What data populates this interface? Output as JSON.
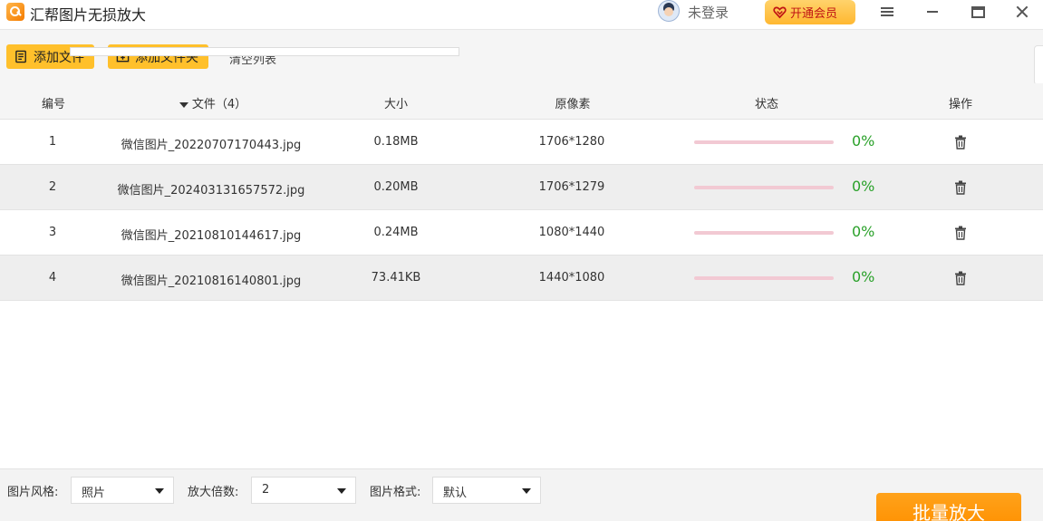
{
  "app": {
    "title": "汇帮图片无损放大",
    "login_label": "未登录",
    "vip_label": "开通会员"
  },
  "toolbar": {
    "add_file_label": "添加文件",
    "add_folder_label": "添加文件夹",
    "clear_label": "清空列表"
  },
  "table": {
    "headers": {
      "index": "编号",
      "file": "文件（4）",
      "size": "大小",
      "pixels": "原像素",
      "status": "状态",
      "action": "操作"
    },
    "rows": [
      {
        "index": "1",
        "file": "微信图片_20220707170443.jpg",
        "size": "0.18MB",
        "pixels": "1706*1280",
        "progress": 0,
        "progress_label": "0%"
      },
      {
        "index": "2",
        "file": "微信图片_202403131657572.jpg",
        "size": "0.20MB",
        "pixels": "1706*1279",
        "progress": 0,
        "progress_label": "0%"
      },
      {
        "index": "3",
        "file": "微信图片_20210810144617.jpg",
        "size": "0.24MB",
        "pixels": "1080*1440",
        "progress": 0,
        "progress_label": "0%"
      },
      {
        "index": "4",
        "file": "微信图片_20210816140801.jpg",
        "size": "73.41KB",
        "pixels": "1440*1080",
        "progress": 0,
        "progress_label": "0%"
      }
    ]
  },
  "options": {
    "style_label": "图片风格:",
    "style_value": "照片",
    "scale_label": "放大倍数:",
    "scale_value": "2",
    "format_label": "图片格式:",
    "format_value": "默认"
  },
  "actions": {
    "batch_label": "批量放大"
  },
  "colors": {
    "accent": "#ffc02b",
    "primary_button": "#ff9800",
    "progress_track": "#f2c9d3",
    "percent_text": "#2aa12a",
    "vip_text": "#c01414"
  },
  "icons": [
    "app-logo-icon",
    "user-avatar-icon",
    "vip-heart-icon",
    "menu-icon",
    "minimize-icon",
    "maximize-icon",
    "close-icon",
    "add-file-icon",
    "add-folder-icon",
    "sort-down-icon",
    "trash-icon",
    "chevron-down-icon"
  ]
}
